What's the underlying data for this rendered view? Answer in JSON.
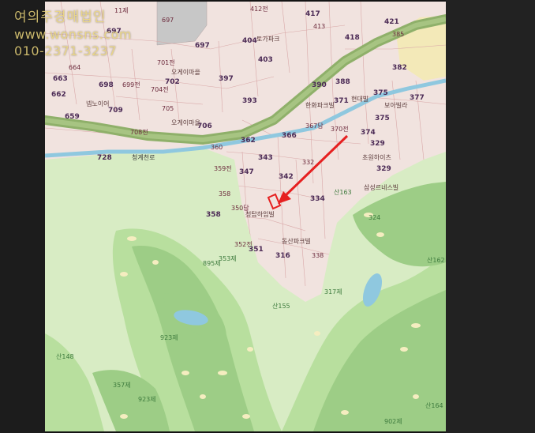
{
  "watermark": {
    "name": "여의주경매법인",
    "url": "www.wonsns.com",
    "phone": "010-2371-3237"
  },
  "map": {
    "colors": {
      "residential": "#f1e3df",
      "parcel_line": "#d9a8a8",
      "greenbelt": "#d8ecc4",
      "golf_fairway": "#9dcd86",
      "golf_rough": "#b8df9e",
      "highway": "#8fb06a",
      "river": "#8fc8df",
      "arrow": "#e62020",
      "target": "#e62020"
    },
    "labels": {
      "l_697": "697",
      "l_697b": "697",
      "l_11": "11제",
      "l_697c": "697",
      "l_404": "404",
      "l_412": "412전",
      "l_417": "417",
      "l_421": "421",
      "l_385": "385",
      "l_664": "664",
      "l_663": "663",
      "l_698": "698",
      "l_699": "699전",
      "l_701": "701전",
      "l_702": "702",
      "l_704": "704전",
      "l_397": "397",
      "l_403": "403",
      "l_390": "390",
      "l_388": "388",
      "l_382": "382",
      "l_662": "662",
      "l_709": "709",
      "l_705": "705",
      "l_393": "393",
      "l_371": "371",
      "l_375": "375",
      "l_377": "377",
      "l_659": "659",
      "l_706": "706",
      "l_708": "708전",
      "l_362": "362",
      "l_366": "366",
      "l_367": "367답",
      "l_370": "370전",
      "l_374": "374",
      "l_329": "329",
      "l_360": "360",
      "l_728": "728",
      "l_343": "343",
      "l_359": "359전",
      "l_347": "347",
      "l_342": "342",
      "l_334": "334",
      "l_358": "358",
      "l_352": "352전",
      "l_350": "350답",
      "l_351": "351",
      "l_316": "316",
      "l_338": "338",
      "l_363": "산163",
      "l_324": "324",
      "l_895": "895제",
      "l_353": "353제",
      "l_317": "317제",
      "l_162": "산162",
      "l_155": "산155",
      "l_923": "923제",
      "l_148": "산148",
      "l_357": "357제",
      "l_902": "902제",
      "l_164": "산164",
      "l_413": "413",
      "l_418": "418",
      "l_332": "332"
    },
    "places": {
      "p_owl": "오게이마을",
      "p_nep": "넵노이어",
      "p_chunk": "청탑하임빌",
      "p_samsung": "삼성르네스빌",
      "p_chowon": "초원하이츠",
      "p_hanwha": "한화파크빌",
      "p_hyundai": "현대빌",
      "p_boa": "보아빌라",
      "p_road1": "청계천로",
      "p_toga": "토가파크",
      "p_dongsan": "동산파크빌"
    }
  }
}
